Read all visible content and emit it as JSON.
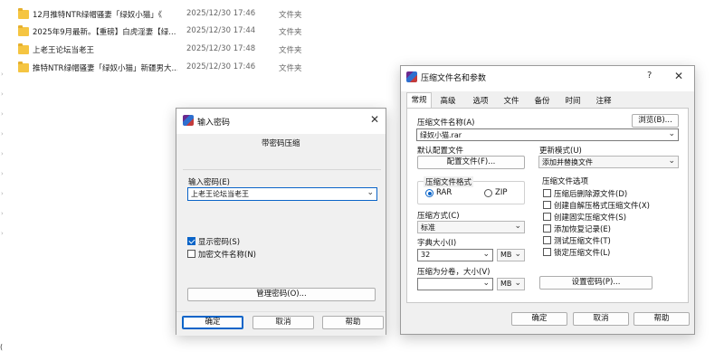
{
  "files": [
    {
      "name": "12月推特NTR绿帽骚妻「绿奴小猫」《",
      "date": "2025/12/30 17:46",
      "type": "文件夹"
    },
    {
      "name": "2025年9月最新。【重磅】白虎淫妻【绿...",
      "date": "2025/12/30 17:44",
      "type": "文件夹"
    },
    {
      "name": "上老王论坛当老王",
      "date": "2025/12/30 17:48",
      "type": "文件夹"
    },
    {
      "name": "推特NTR绿帽骚妻「绿奴小猫」新疆男大...",
      "date": "2025/12/30 17:46",
      "type": "文件夹"
    }
  ],
  "left_edge_text": "(",
  "password_dialog": {
    "title": "输入密码",
    "subtitle": "带密码压缩",
    "password_label": "输入密码(E)",
    "password_value": "上老王论坛当老王",
    "show_password": "显示密码(S)",
    "encrypt_filenames": "加密文件名称(N)",
    "manage_btn": "管理密码(O)...",
    "ok": "确定",
    "cancel": "取消",
    "help": "帮助"
  },
  "archive_dialog": {
    "title": "压缩文件名和参数",
    "help_icon": "?",
    "tabs": [
      "常规",
      "高级",
      "选项",
      "文件",
      "备份",
      "时间",
      "注释"
    ],
    "archive_name_label": "压缩文件名称(A)",
    "browse": "浏览(B)...",
    "archive_name_value": "绿奴小猫.rar",
    "default_profile_label": "默认配置文件",
    "profiles_btn": "配置文件(F)...",
    "update_mode_label": "更新模式(U)",
    "update_mode_value": "添加并替换文件",
    "format_group": "压缩文件格式",
    "format_rar": "RAR",
    "format_zip": "ZIP",
    "method_label": "压缩方式(C)",
    "method_value": "标准",
    "dict_label": "字典大小(I)",
    "dict_value": "32",
    "dict_unit": "MB",
    "split_label": "压缩为分卷，大小(V)",
    "split_value": "",
    "split_unit": "MB",
    "options_group": "压缩文件选项",
    "options": [
      "压缩后删除源文件(D)",
      "创建自解压格式压缩文件(X)",
      "创建固实压缩文件(S)",
      "添加恢复记录(E)",
      "测试压缩文件(T)",
      "锁定压缩文件(L)"
    ],
    "set_password": "设置密码(P)...",
    "ok": "确定",
    "cancel": "取消",
    "help": "帮助"
  }
}
